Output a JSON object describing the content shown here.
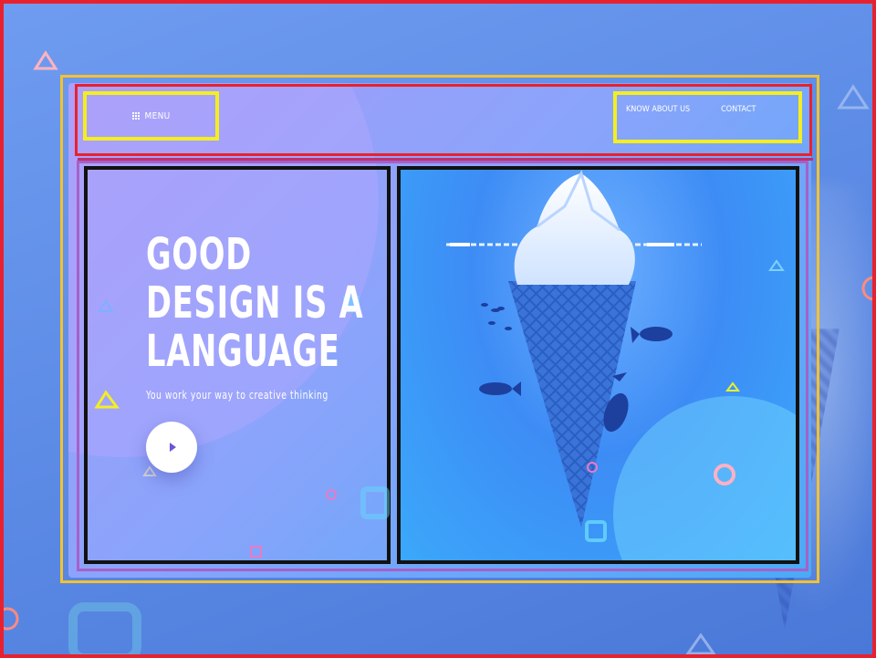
{
  "header": {
    "menu_label": "MENU",
    "nav": {
      "know_about_us": "KNOW ABOUT US",
      "contact": "CONTACT"
    }
  },
  "hero": {
    "headline_lines": [
      "GOOD",
      "DESIGN IS A",
      "LANGUAGE"
    ],
    "subline": "You work your way to creative thinking",
    "play_button": "play"
  },
  "icons": {
    "menu": "grid-menu-icon",
    "play": "play-icon",
    "illustration": "iceberg-ice-cream-cone-illustration"
  },
  "colors": {
    "accent_play": "#6a56d8",
    "frame_red": "#e8212f",
    "frame_yellow": "#f4ee22",
    "frame_gold": "#f2c230",
    "frame_black": "#111111",
    "frame_purple": "#a561c8"
  }
}
